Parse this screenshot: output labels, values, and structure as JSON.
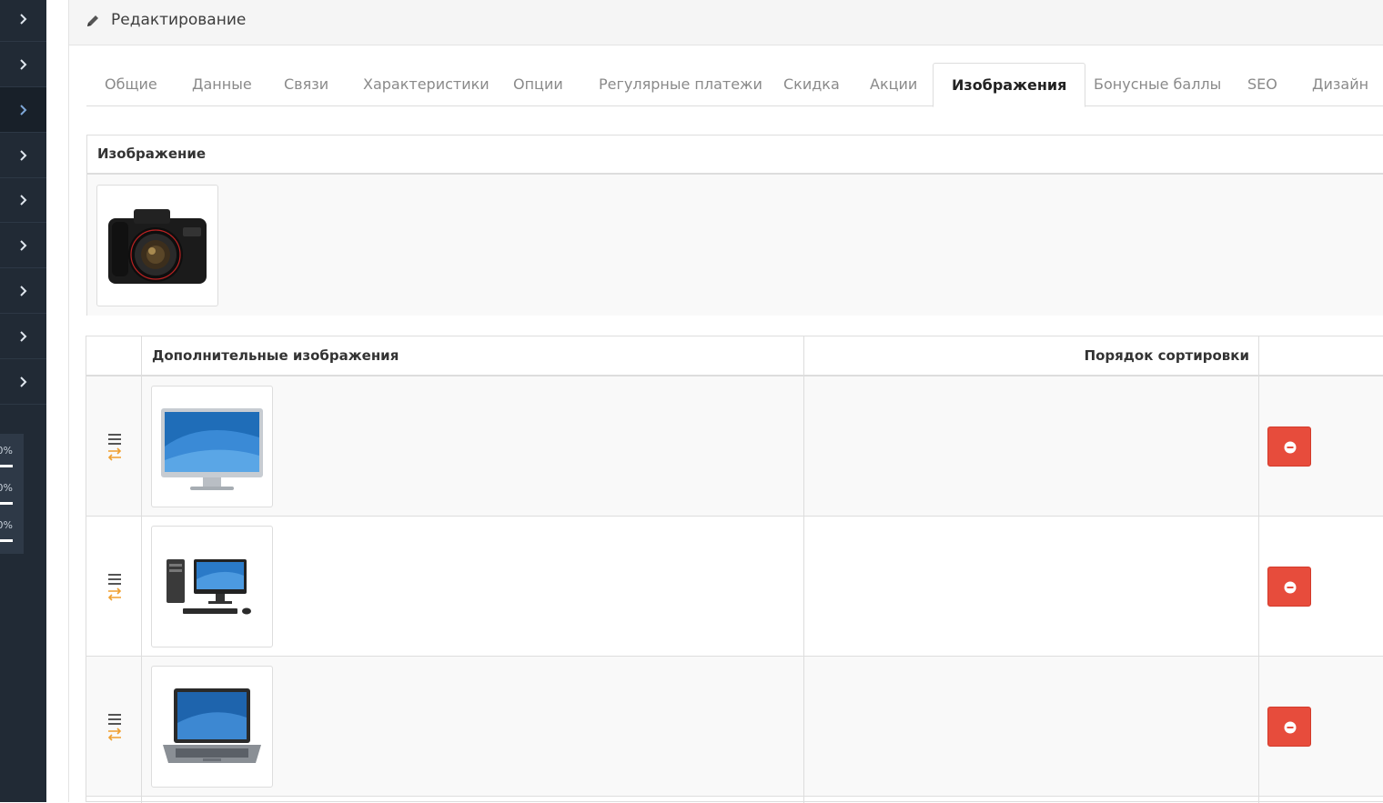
{
  "sidebar": {
    "menu_items": [
      "chevron-right-icon",
      "chevron-right-icon",
      "chevron-right-icon",
      "chevron-right-icon",
      "chevron-right-icon",
      "chevron-right-icon",
      "chevron-right-icon",
      "chevron-right-icon",
      "chevron-right-icon"
    ],
    "active_index": 2,
    "stats": [
      {
        "label": "0%",
        "fill": 1.0
      },
      {
        "label": "0%",
        "fill": 1.0
      },
      {
        "label": "0%",
        "fill": 1.0
      }
    ]
  },
  "panel": {
    "title": "Редактирование",
    "icon": "pencil-icon"
  },
  "tabs": [
    {
      "label": "Общие",
      "active": false
    },
    {
      "label": "Данные",
      "active": false
    },
    {
      "label": "Связи",
      "active": false
    },
    {
      "label": "Характеристики",
      "active": false
    },
    {
      "label": "Опции",
      "active": false
    },
    {
      "label": "Регулярные платежи",
      "active": false
    },
    {
      "label": "Скидка",
      "active": false
    },
    {
      "label": "Акции",
      "active": false
    },
    {
      "label": "Изображения",
      "active": true
    },
    {
      "label": "Бонусные баллы",
      "active": false
    },
    {
      "label": "SEO",
      "active": false
    },
    {
      "label": "Дизайн",
      "active": false
    }
  ],
  "main_image": {
    "header": "Изображение",
    "image": "camera"
  },
  "additional_images": {
    "headers": {
      "images": "Дополнительные изображения",
      "sort_order": "Порядок сортировки"
    },
    "rows": [
      {
        "image": "monitor",
        "sort_order": ""
      },
      {
        "image": "desktop-pc",
        "sort_order": ""
      },
      {
        "image": "laptop",
        "sort_order": ""
      }
    ]
  },
  "colors": {
    "sidebar_bg": "#212a35",
    "delete_button": "#e74c3c",
    "drag_accent": "#f0a030"
  }
}
